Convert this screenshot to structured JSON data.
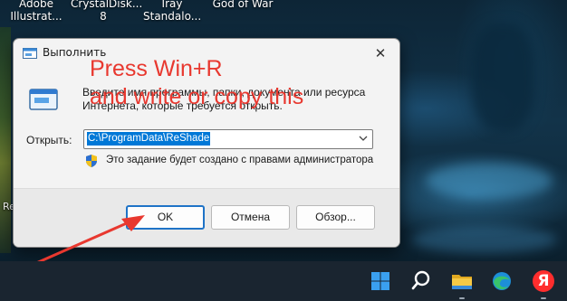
{
  "desktop": {
    "icons": [
      {
        "line1": "Adobe",
        "line2": "Illustrat..."
      },
      {
        "line1": "CrystalDisk...",
        "line2": "8"
      },
      {
        "line1": "Iray",
        "line2": "Standalo..."
      },
      {
        "line1": "God of War",
        "line2": ""
      }
    ],
    "fragment": "Re"
  },
  "run_dialog": {
    "title": "Выполнить",
    "close_glyph": "✕",
    "description": "Введите имя программы, папки, документа или ресурса Интернета, которые требуется открыть.",
    "open_label": "Открыть:",
    "open_value": "C:\\ProgramData\\ReShade",
    "admin_note": "Это задание будет создано с правами администратора",
    "buttons": {
      "ok": "OK",
      "cancel": "Отмена",
      "browse": "Обзор..."
    }
  },
  "annotation": {
    "line1": "Press Win+R",
    "line2": "and write or copy this",
    "color": "#e8382f"
  },
  "taskbar": {
    "icons": [
      "windows-start-icon",
      "search-icon",
      "file-explorer-icon",
      "edge-icon",
      "yandex-browser-icon"
    ],
    "yandex_glyph": "Я"
  }
}
